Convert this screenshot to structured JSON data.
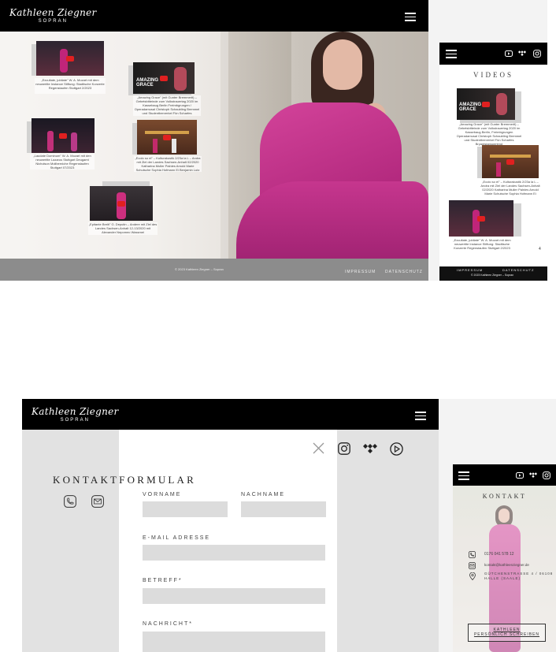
{
  "site": {
    "logo_name": "Kathleen Ziegner",
    "logo_sub": "SOPRAN"
  },
  "desktop_videos": {
    "videos": [
      {
        "caption": "„Excultate, jubilate\" W. A. Mozart mit dem neuwertite Instance Stiftung: Stadtische Konzerte Regenstaufen Stuttgart 2/2023"
      },
      {
        "caption": "„Amazing Grace\" (mit Gunter Bremmerlt) – Gebetsbitteinde zum Volkstrauertag 2020 im Kassebaug Berlin Freimbgrungen / Operadamusal Christoph Schaubling Bremmel und Studentberverkel Fün Scharfes Bryantstansperlend"
      },
      {
        "caption": "„Laudate Dominum\" W. A. Mozart mit den neuwertite Lazarus Stuttgart Deugamt Nicholson Moliberniche Regenstaufen Stuttgart 07/2023"
      },
      {
        "caption": "„Ecolo so el\" – Kulturakustik 2/23a la L – Andra mit Ziel der Landes Sachsen-Anhalt 02/2020 Katharina Muller Palnies Arnold Marie Schutsche Sophia Hofmann Ei Benjamin Lutz"
      },
      {
        "caption": "„Epitante Breiti\" G. Deputin – Andere mit Ziel des Landes Sachsen-Anhalt 12-13/2020 mit Alexander Nepomeo Wassmei"
      }
    ],
    "footer_copyright": "© 2023 Kathleen Ziegner – Sopran",
    "footer_links": [
      "IMPRESSUM",
      "DATENSCHUTZ"
    ]
  },
  "mobile_videos": {
    "heading": "VIDEOS",
    "videos": [
      {
        "caption": "„Amazing Grace\" (mit Gunter Bremmerlt) – Gebetsbitteinde zum Volkstrauertag 2020 im Kassebaug Berlin, Freimbgrungen Operadamusal Christoph Schaubling Bremmel und Studentberverkel Fün Scharfes Bryantstansperlend"
      },
      {
        "caption": "„Ecolo so el\" – Kulturakustik 2/23a la L – Andra mit Ziel der Landes Sachsen-Anhalt 02/2020 Katharina Muller Palnies Arnold Marie Schutsche Sophia Hofmann Ei Benjamin Lutz"
      },
      {
        "caption": "„Excultate, jubilate\" W. A. Mozart mit dem neuwertite Instance Stiftung: Stadtische Konzerte Regenstaufen Stuttgart 2/2023"
      }
    ],
    "page_number": "4",
    "footer_links": [
      "IMPRESSUM",
      "DATENSCHUTZ"
    ],
    "footer_copyright": "© 2023 Kathleen Ziegner – Sopran"
  },
  "contact": {
    "title": "KONTAKTFORMULAR",
    "fields": {
      "firstname": "VORNAME",
      "lastname": "NACHNAME",
      "email": "E-MAIL ADRESSE",
      "subject": "BETREFF*",
      "message": "NACHRICHT*"
    }
  },
  "mobile_contact": {
    "heading": "KONTAKT",
    "phone": "0176 041 578 12",
    "email": "kontakt@kathleenziegner.de",
    "address": "GÜTCHENSTRASSE 4 / 06108 HALLE (SAALE)",
    "address_line1": "GÜTCHENSTRASSE 4 / 06108",
    "address_line2": "HALLE (SAALE)",
    "cta_line1": "KATHLEEN",
    "cta_line2": "PERSÖNLICH SCHREIBEN"
  },
  "icons": {
    "instagram": "instagram-icon",
    "tidal": "tidal-icon",
    "youtube": "youtube-icon",
    "phone": "phone-icon",
    "mail": "mail-icon",
    "location": "location-icon",
    "close": "close-icon",
    "menu": "hamburger-menu-icon"
  },
  "colors": {
    "header_bg": "#000000",
    "dress_pink": "#c2308a",
    "field_bg": "#dcdcdc",
    "panel_gray": "#e2e2e2"
  }
}
